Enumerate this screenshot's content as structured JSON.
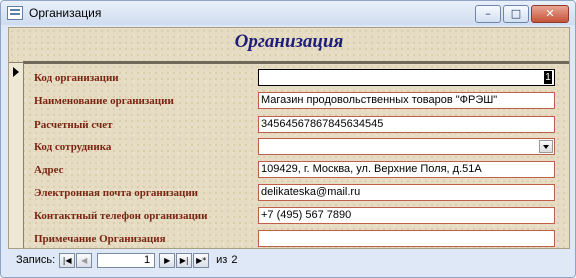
{
  "window": {
    "title": "Организация",
    "icon": "form-icon",
    "buttons": {
      "minimize": "–",
      "maximize": "□",
      "close": "✕"
    }
  },
  "form": {
    "title": "Организация",
    "record_value_indicator": "1",
    "fields": [
      {
        "label": "Код организации",
        "value": ""
      },
      {
        "label": "Наименование организации",
        "value": "Магазин продовольственных товаров \"ФРЭШ\""
      },
      {
        "label": "Расчетный счет",
        "value": "34564567867845634545"
      },
      {
        "label": "Код сотрудника",
        "value": ""
      },
      {
        "label": "Адрес",
        "value": "109429, г. Москва, ул. Верхние Поля, д.51А"
      },
      {
        "label": "Электронная почта организации",
        "value": "delikateska@mail.ru"
      },
      {
        "label": "Контактный телефон организации",
        "value": "+7 (495) 567 7890"
      },
      {
        "label": "Примечание Организация",
        "value": ""
      }
    ]
  },
  "navigation": {
    "label": "Запись:",
    "first": "|◀",
    "prev": "◀",
    "current": "1",
    "next": "▶",
    "last": "▶|",
    "new": "▶*",
    "of_label": "из",
    "total": "2"
  }
}
